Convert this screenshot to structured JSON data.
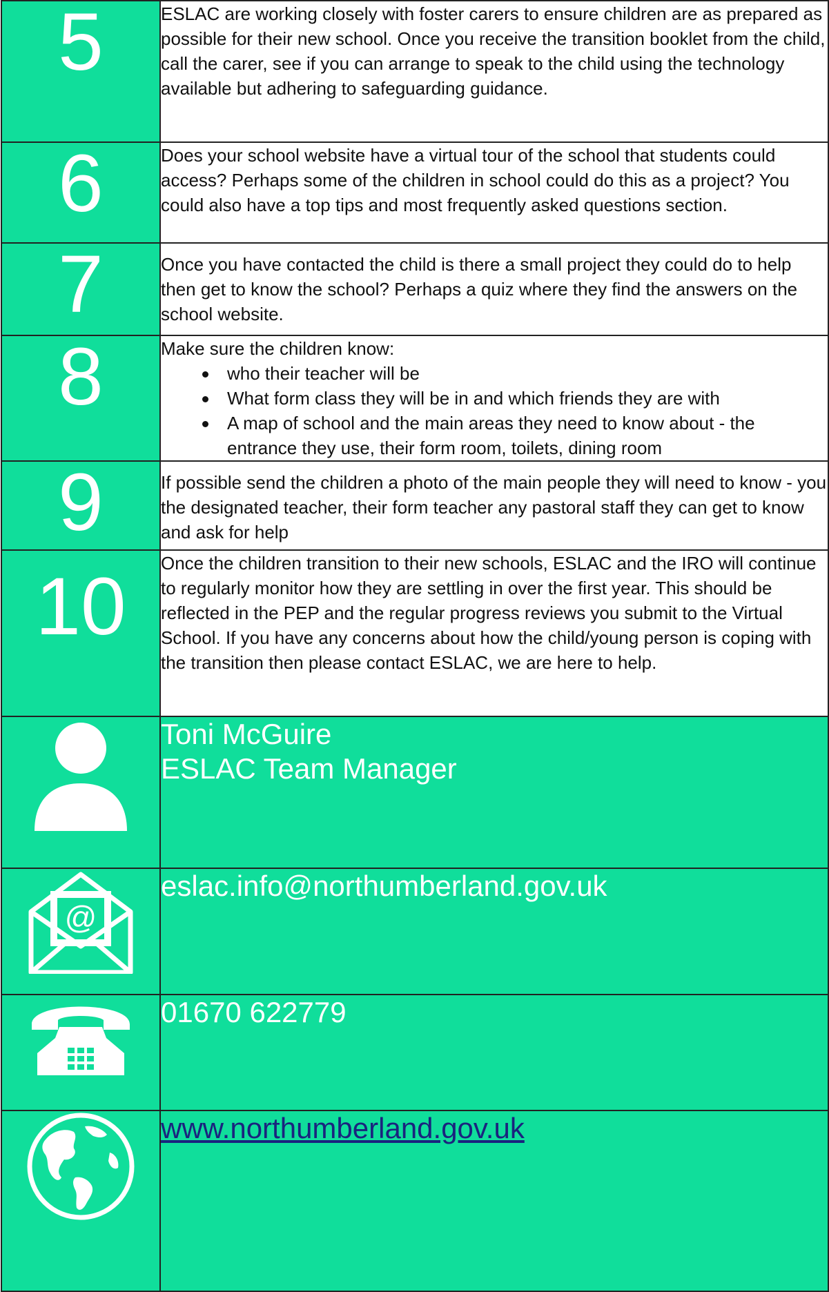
{
  "steps": [
    {
      "number": "5",
      "text": "ESLAC are working closely with foster carers to ensure children are as prepared as possible for their new school. Once you receive the transition booklet from the child, call the carer, see if you can arrange to speak to the child using the technology available but adhering to safeguarding guidance."
    },
    {
      "number": "6",
      "text": "Does your school website have a virtual tour of the school that students could access? Perhaps some of the children in school could do this as a project? You could also have a top tips and most frequently asked questions section."
    },
    {
      "number": "7",
      "text": "Once you have contacted the child is there a small project they could do to help then get to know the school?  Perhaps a quiz where they find the answers on the school website."
    },
    {
      "number": "8",
      "intro": "Make sure the children know:",
      "bullets": [
        "who their teacher will be",
        "What form class they will be in and which friends they are with",
        "A map of school and the main areas they need to know about - the entrance they use, their form room, toilets, dining room"
      ]
    },
    {
      "number": "9",
      "text": "If possible send the children a photo of the main people they will need to know - you the designated teacher, their form teacher any pastoral staff they can get to know and ask for help"
    },
    {
      "number": "10",
      "text": "Once the children transition to their new schools, ESLAC and the IRO will continue to regularly monitor how they are settling in over the first year. This should be reflected in the PEP and the regular progress reviews you submit to the Virtual School.  If you have any concerns about how the child/young person is coping with the transition then please contact ESLAC, we are here to help."
    }
  ],
  "contacts": {
    "person": {
      "icon": "person-icon",
      "name": "Toni McGuire",
      "role": "ESLAC Team Manager"
    },
    "email": {
      "icon": "email-envelope-icon",
      "value": "eslac.info@northumberland.gov.uk"
    },
    "phone": {
      "icon": "telephone-icon",
      "value": "01670 622779"
    },
    "web": {
      "icon": "globe-icon",
      "value": "www.northumberland.gov.uk"
    }
  },
  "colors": {
    "accent": "#10DE9B",
    "link": "#1a237e",
    "border": "#222222"
  }
}
